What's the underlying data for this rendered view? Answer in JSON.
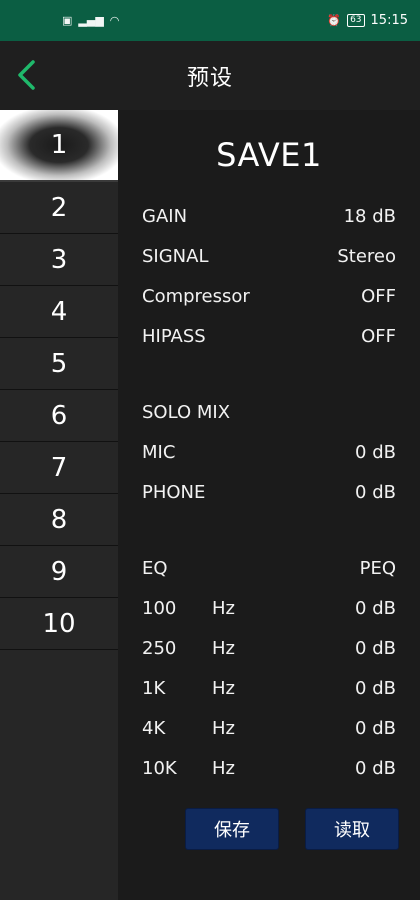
{
  "status_bar": {
    "left_icons": [
      "sim-icon",
      "signal-icon",
      "wifi-icon"
    ],
    "alarm_icon": "alarm-icon",
    "battery": "63",
    "time": "15:15"
  },
  "header": {
    "title": "预设",
    "back_icon": "chevron-left-icon"
  },
  "sidebar": {
    "items": [
      {
        "label": "1"
      },
      {
        "label": "2"
      },
      {
        "label": "3"
      },
      {
        "label": "4"
      },
      {
        "label": "5"
      },
      {
        "label": "6"
      },
      {
        "label": "7"
      },
      {
        "label": "8"
      },
      {
        "label": "9"
      },
      {
        "label": "10"
      }
    ],
    "selected": "1"
  },
  "preset": {
    "name": "SAVE1",
    "gain": {
      "label": "GAIN",
      "value": "18  dB"
    },
    "signal": {
      "label": "SIGNAL",
      "value": "Stereo"
    },
    "compressor": {
      "label": "Compressor",
      "value": "OFF"
    },
    "hipass": {
      "label": "HIPASS",
      "value": "OFF"
    },
    "solo_mix": {
      "label": "SOLO MIX"
    },
    "mic": {
      "label": "MIC",
      "value": "0  dB"
    },
    "phone": {
      "label": "PHONE",
      "value": "0  dB"
    },
    "eq": {
      "label": "EQ",
      "value": "PEQ"
    },
    "eq_bands": [
      {
        "freq": "100",
        "unit": "Hz",
        "value": "0  dB"
      },
      {
        "freq": "250",
        "unit": "Hz",
        "value": "0  dB"
      },
      {
        "freq": "1K",
        "unit": "Hz",
        "value": "0  dB"
      },
      {
        "freq": "4K",
        "unit": "Hz",
        "value": "0  dB"
      },
      {
        "freq": "10K",
        "unit": "Hz",
        "value": "0  dB"
      }
    ]
  },
  "buttons": {
    "save": "保存",
    "load": "读取"
  },
  "colors": {
    "status_bar": "#0b5e43",
    "back_arrow": "#1fb96b",
    "button_bg": "#102a5e"
  }
}
